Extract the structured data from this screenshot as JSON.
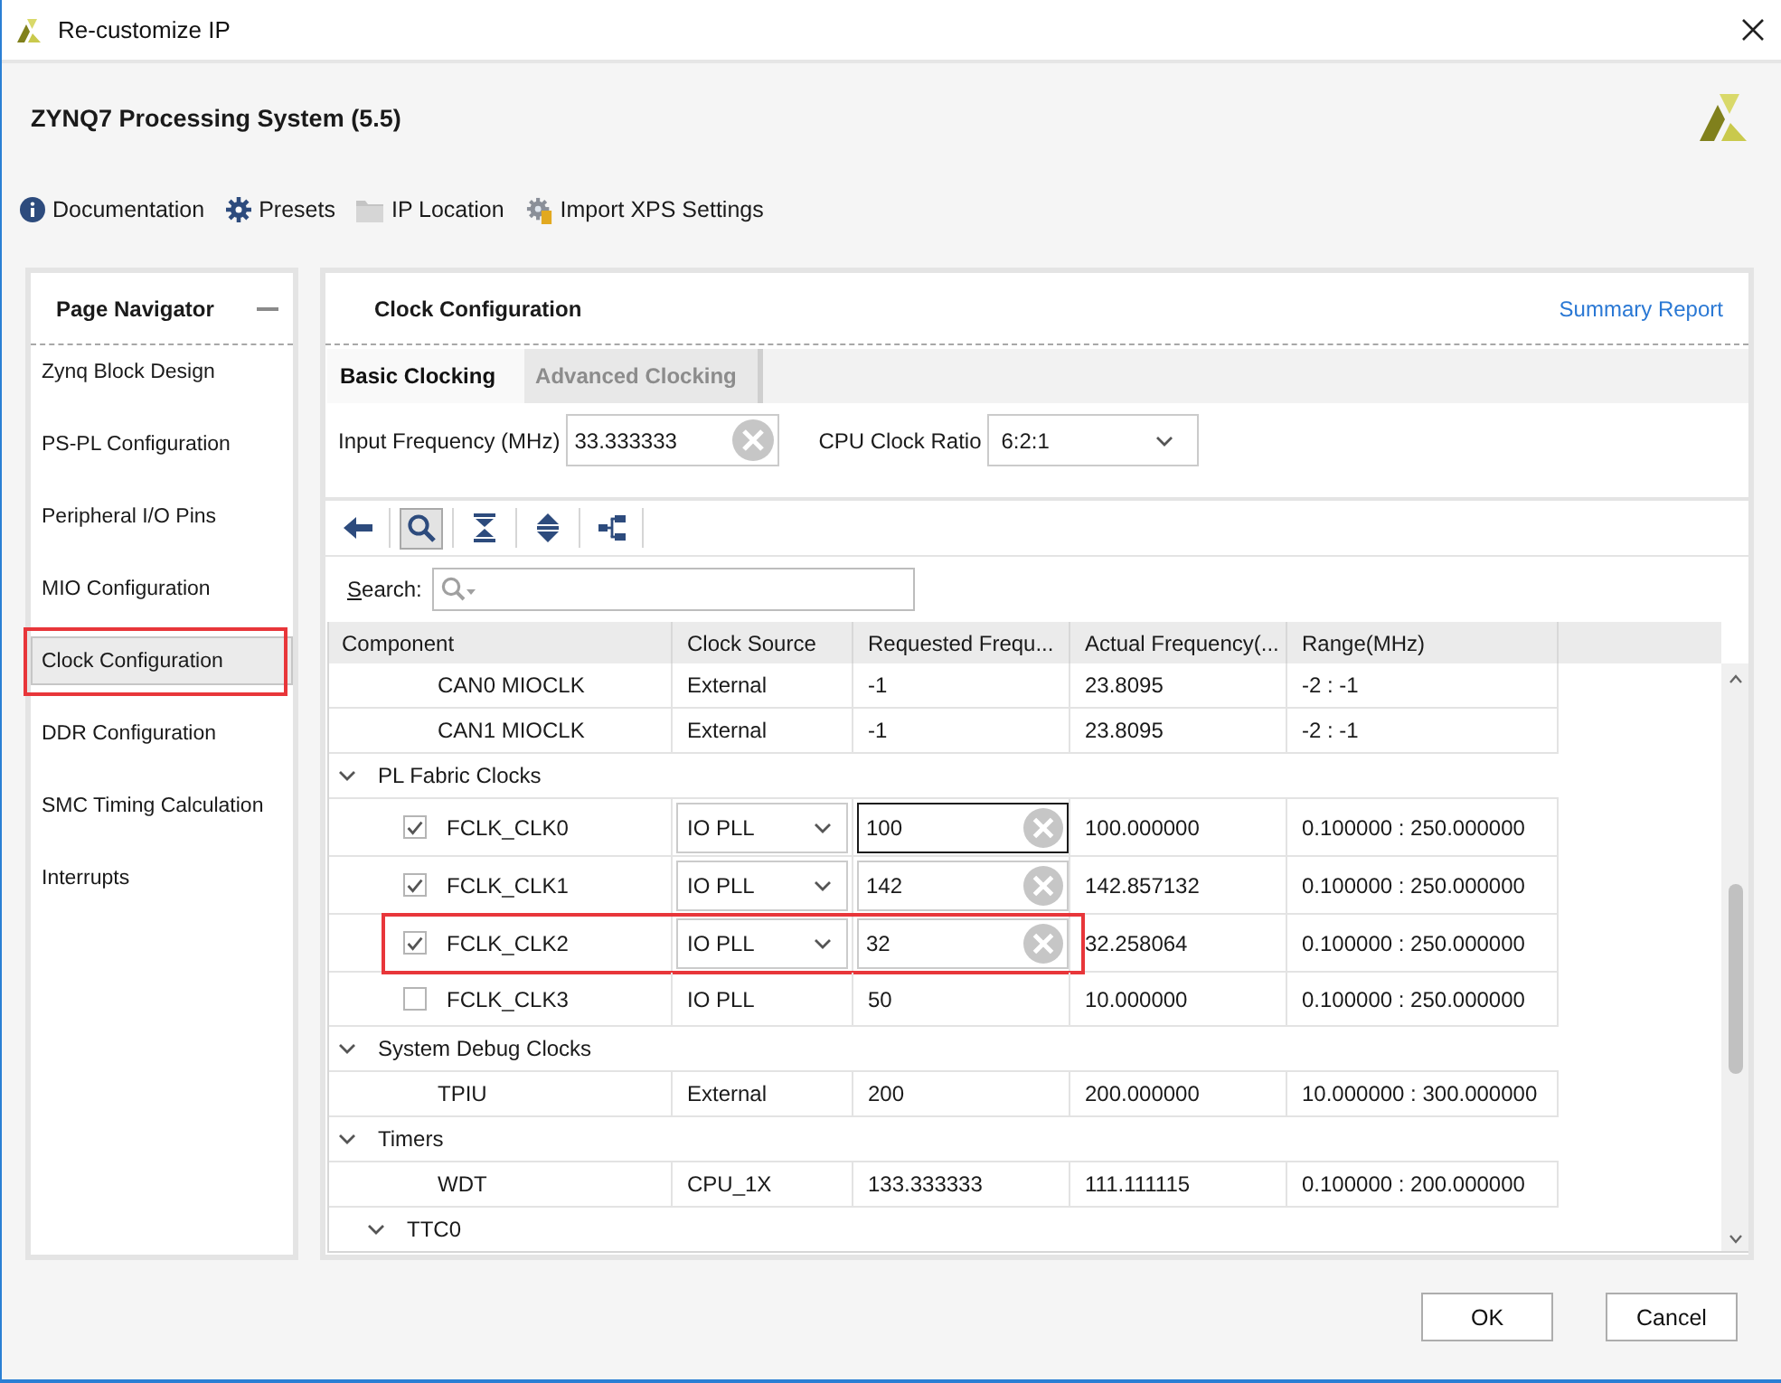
{
  "window": {
    "title": "Re-customize IP"
  },
  "header": {
    "title": "ZYNQ7 Processing System (5.5)"
  },
  "toolbar": [
    {
      "label": "Documentation"
    },
    {
      "label": "Presets"
    },
    {
      "label": "IP Location"
    },
    {
      "label": "Import XPS Settings"
    }
  ],
  "navigator": {
    "title": "Page Navigator",
    "items": [
      {
        "label": "Zynq Block Design",
        "selected": false,
        "annotated": false
      },
      {
        "label": "PS-PL Configuration",
        "selected": false,
        "annotated": false
      },
      {
        "label": "Peripheral I/O Pins",
        "selected": false,
        "annotated": false
      },
      {
        "label": "MIO Configuration",
        "selected": false,
        "annotated": false
      },
      {
        "label": "Clock Configuration",
        "selected": true,
        "annotated": true
      },
      {
        "label": "DDR Configuration",
        "selected": false,
        "annotated": false
      },
      {
        "label": "SMC Timing Calculation",
        "selected": false,
        "annotated": false
      },
      {
        "label": "Interrupts",
        "selected": false,
        "annotated": false
      }
    ]
  },
  "page": {
    "title": "Clock Configuration",
    "link": "Summary Report"
  },
  "tabs": [
    {
      "label": "Basic Clocking",
      "selected": true
    },
    {
      "label": "Advanced Clocking",
      "selected": false
    }
  ],
  "input_frequency": {
    "label": "Input Frequency (MHz)",
    "value": "33.333333"
  },
  "cpu_clock_ratio": {
    "label": "CPU Clock Ratio",
    "value": "6:2:1"
  },
  "tree_tools": [
    {
      "selected": false
    },
    {
      "selected": true
    },
    {
      "selected": false
    },
    {
      "selected": false
    },
    {
      "selected": false
    }
  ],
  "search": {
    "label": "Search:"
  },
  "table": {
    "columns": [
      "Component",
      "Clock Source",
      "Requested Frequ...",
      "Actual Frequency(...",
      "Range(MHz)"
    ],
    "rows": [
      {
        "kind": "group",
        "children": [
          {
            "kind": "clock",
            "component": "CAN0 MIOCLK",
            "clock_source": "External",
            "requested": "-1",
            "actual": "23.8095",
            "range": "-2 : -1"
          },
          {
            "kind": "clock",
            "component": "CAN1 MIOCLK",
            "clock_source": "External",
            "requested": "-1",
            "actual": "23.8095",
            "range": "-2 : -1"
          }
        ]
      },
      {
        "kind": "group",
        "label": "PL Fabric Clocks",
        "expanded": true,
        "children": [
          {
            "kind": "fabric_clock",
            "checked": true,
            "focused": true,
            "component": "FCLK_CLK0",
            "clock_source": "IO PLL",
            "requested": "100",
            "actual": "100.000000",
            "range": "0.100000 : 250.000000"
          },
          {
            "kind": "fabric_clock",
            "checked": true,
            "focused": false,
            "component": "FCLK_CLK1",
            "clock_source": "IO PLL",
            "requested": "142",
            "actual": "142.857132",
            "range": "0.100000 : 250.000000"
          },
          {
            "kind": "fabric_clock",
            "checked": true,
            "focused": false,
            "annotated": true,
            "component": "FCLK_CLK2",
            "clock_source": "IO PLL",
            "requested": "32",
            "actual": "32.258064",
            "range": "0.100000 : 250.000000"
          },
          {
            "kind": "fabric_clock",
            "checked": false,
            "component": "FCLK_CLK3",
            "clock_source": "IO PLL",
            "requested": "50",
            "actual": "10.000000",
            "range": "0.100000 : 250.000000"
          }
        ]
      },
      {
        "kind": "group",
        "label": "System Debug Clocks",
        "expanded": true,
        "children": [
          {
            "kind": "clock",
            "component": "TPIU",
            "clock_source": "External",
            "requested": "200",
            "actual": "200.000000",
            "range": "10.000000 : 300.000000"
          }
        ]
      },
      {
        "kind": "group",
        "label": "Timers",
        "expanded": true,
        "children": [
          {
            "kind": "clock",
            "component": "WDT",
            "clock_source": "CPU_1X",
            "requested": "133.333333",
            "actual": "111.111115",
            "range": "0.100000 : 200.000000"
          },
          {
            "kind": "group",
            "label": "TTC0",
            "expanded": true
          }
        ]
      }
    ]
  },
  "buttons": [
    {
      "label": "OK"
    },
    {
      "label": "Cancel"
    }
  ]
}
